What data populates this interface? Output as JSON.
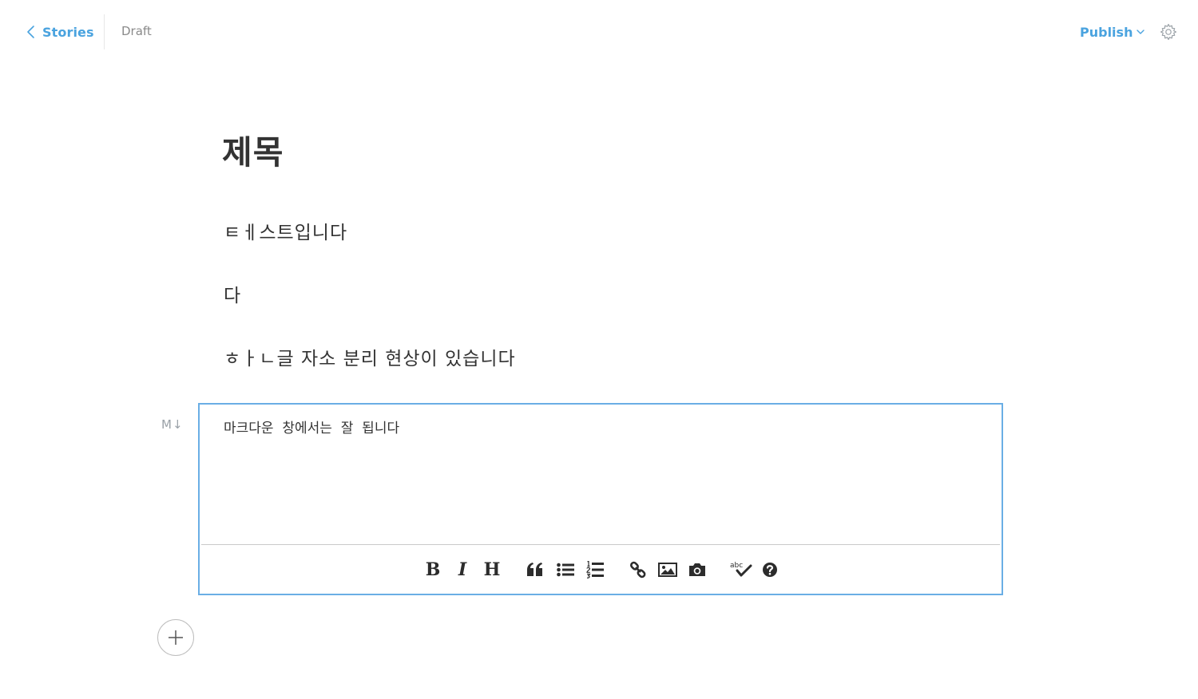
{
  "header": {
    "back_label": "Stories",
    "status": "Draft",
    "publish_label": "Publish"
  },
  "document": {
    "title": "제목",
    "paragraphs": [
      "ㅌㅔ스트입니다",
      "다",
      "ㅎㅏㄴ글 자소 분리 현상이 있습니다"
    ]
  },
  "markdown_editor": {
    "badge": "M↓",
    "content": "마크다운  창에서는  잘  됩니다",
    "toolbar": {
      "bold": "B",
      "italic": "I",
      "heading": "H",
      "spellcheck_abc": "abc"
    }
  },
  "colors": {
    "accent": "#4aa3df",
    "editor_border": "#6aaee5",
    "text": "#333333",
    "muted": "#8a8a8a"
  },
  "icons": {
    "back": "chevron-left-icon",
    "publish_caret": "chevron-down-icon",
    "settings": "gear-icon",
    "quote": "quote-icon",
    "unordered_list": "bullet-list-icon",
    "ordered_list": "numbered-list-icon",
    "link": "link-icon",
    "image": "image-icon",
    "camera": "camera-icon",
    "spellcheck": "spellcheck-icon",
    "help": "help-icon",
    "add": "plus-icon"
  }
}
